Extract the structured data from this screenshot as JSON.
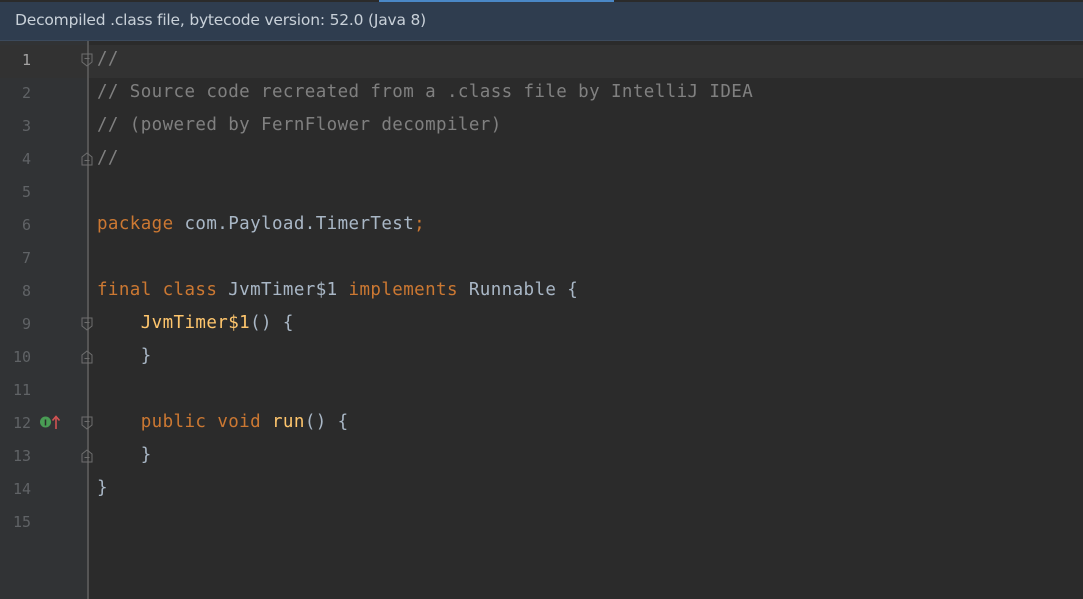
{
  "banner": {
    "text": "Decompiled .class file, bytecode version: 52.0 (Java 8)"
  },
  "colors": {
    "background": "#2b2b2b",
    "gutter": "#313335",
    "banner": "#2f3d4f",
    "comment": "#808080",
    "keyword": "#cc7832",
    "function": "#ffc66d",
    "plain": "#a9b7c6",
    "line_number": "#606366"
  },
  "editor": {
    "line_numbers": [
      "1",
      "2",
      "3",
      "4",
      "5",
      "6",
      "7",
      "8",
      "9",
      "10",
      "11",
      "12",
      "13",
      "14",
      "15"
    ],
    "lines": {
      "l1": "//",
      "l2": "// Source code recreated from a .class file by IntelliJ IDEA",
      "l3": "// (powered by FernFlower decompiler)",
      "l4": "//",
      "l6_kw": "package",
      "l6_rest": " com.Payload.TimerTest",
      "l6_semi": ";",
      "l8_kw1": "final",
      "l8_kw2": "class",
      "l8_name": "JvmTimer$1",
      "l8_kw3": "implements",
      "l8_rest": "Runnable {",
      "l9_fn": "JvmTimer$1",
      "l9_rest": "() {",
      "l10": "}",
      "l12_kw1": "public",
      "l12_kw2": "void",
      "l12_fn": "run",
      "l12_rest": "() {",
      "l13": "}",
      "l14": "}"
    }
  },
  "gutter_icons": {
    "line_12": "implementing-method-icon"
  }
}
